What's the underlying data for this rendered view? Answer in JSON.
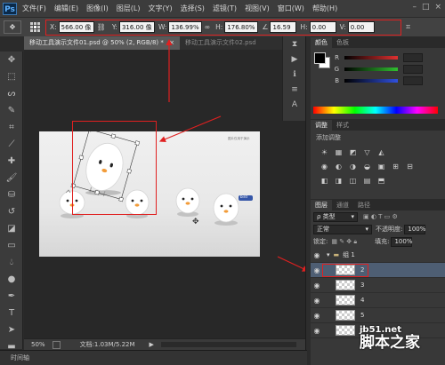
{
  "app": {
    "logo": "Ps"
  },
  "menu": [
    "文件(F)",
    "编辑(E)",
    "图像(I)",
    "图层(L)",
    "文字(Y)",
    "选择(S)",
    "滤镜(T)",
    "视图(V)",
    "窗口(W)",
    "帮助(H)"
  ],
  "window_controls": [
    "–",
    "□",
    "×"
  ],
  "options_bar": {
    "x_label": "X:",
    "x_value": "566.00 像",
    "y_label": "Y:",
    "y_value": "316.00 像",
    "w_label": "W:",
    "w_value": "136.99%",
    "h_label": "H:",
    "h_value": "176.80%",
    "angle_value": "16.59",
    "hskew_label": "H:",
    "hskew_value": "0.00",
    "vskew_label": "V:",
    "vskew_value": "0.00"
  },
  "document_tabs": [
    {
      "label": "移动工具演示文件01.psd @ 50% (2, RGB/8) *",
      "close": "×"
    },
    {
      "label": "移动工具演示文件02.psd"
    }
  ],
  "status_bar": {
    "zoom": "50%",
    "doc_info": "文档:1.03M/5.22M"
  },
  "timeline": {
    "label": "时间轴"
  },
  "color_panel": {
    "tabs": [
      "颜色",
      "色板"
    ],
    "channels": [
      {
        "label": "R",
        "color": "#e03030"
      },
      {
        "label": "G",
        "color": "#30c030"
      },
      {
        "label": "B",
        "color": "#3050e0"
      }
    ]
  },
  "adjustments_panel": {
    "tabs": [
      "调整",
      "样式"
    ],
    "title": "添加调整",
    "icons_row1": [
      "☀",
      "▦",
      "◩",
      "▽",
      "◭"
    ],
    "icons_row2": [
      "◉",
      "◐",
      "◑",
      "◒",
      "▣",
      "⊞",
      "⊟"
    ],
    "icons_row3": [
      "◧",
      "◨",
      "◫",
      "▤",
      "⬒"
    ]
  },
  "layers_panel": {
    "tabs": [
      "图层",
      "通道",
      "路径"
    ],
    "blend_mode": "正常",
    "opacity_label": "不透明度:",
    "opacity_value": "100%",
    "lock_label": "锁定:",
    "fill_label": "填充:",
    "fill_value": "100%",
    "group_name": "组 1",
    "layers": [
      {
        "name": "2",
        "selected": true
      },
      {
        "name": "3",
        "selected": false
      },
      {
        "name": "4",
        "selected": false
      },
      {
        "name": "5",
        "selected": false
      },
      {
        "name": "6",
        "selected": false
      }
    ]
  },
  "canvas_text": {
    "small_caption": "图片仅用于演示",
    "mascot_tag": "bird"
  },
  "watermark": {
    "site": "jb51.net",
    "name": "脚本之家"
  },
  "colors": {
    "annotation_red": "#e02020",
    "selected_layer": "#4e5e73",
    "foreground": "#000000",
    "background": "#ffffff"
  }
}
